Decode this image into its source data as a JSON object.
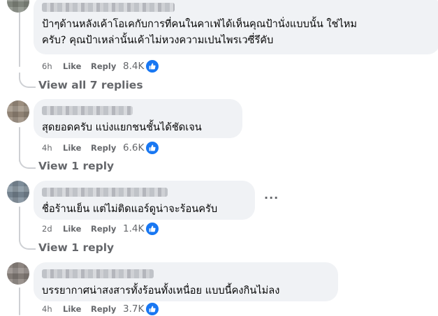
{
  "comments": [
    {
      "avatar_color": "#8a8f86",
      "text": "ป้าๆด้านหลังเค้าโอเคกับการที่คนในคาเฟ่ได้เห็นคุณป้านั่งแบบนั้น ใช่ไหม\nครับ? คุณป้าเหล่านั้นเค้าไม่หวงความเปนไพรเวซี่รึคับ",
      "time": "6h",
      "like_label": "Like",
      "reply_label": "Reply",
      "reaction_count": "8.4K",
      "reaction_icon": "thumbs-up-icon",
      "view_replies": "View all 7 replies"
    },
    {
      "avatar_color": "#9b8d7e",
      "text": "สุดยอดครับ แบ่งแยกชนชั้นได้ชัดเจน",
      "time": "4h",
      "like_label": "Like",
      "reply_label": "Reply",
      "reaction_count": "6.6K",
      "reaction_icon": "thumbs-up-icon",
      "view_replies": "View 1 reply"
    },
    {
      "avatar_color": "#7d8c99",
      "text": "ชื่อร้านเย็น แต่ไม่ติดแอร์ดูน่าจะร้อนครับ",
      "time": "2d",
      "like_label": "Like",
      "reply_label": "Reply",
      "reaction_count": "1.4K",
      "reaction_icon": "thumbs-up-icon",
      "view_replies": "View 1 reply",
      "more_label": "···"
    },
    {
      "avatar_color": "#8d8580",
      "text": "บรรยากาศน่าสงสารทั้งร้อนทั้งเหนื่อย แบบนี้คงกินไม่ลง",
      "time": "4h",
      "like_label": "Like",
      "reply_label": "Reply",
      "reaction_count": "3.7K",
      "reaction_icon": "thumbs-up-icon"
    }
  ],
  "colors": {
    "bubble": "#f0f2f5",
    "meta_text": "#65676b",
    "like_blue": "#1877f2"
  }
}
